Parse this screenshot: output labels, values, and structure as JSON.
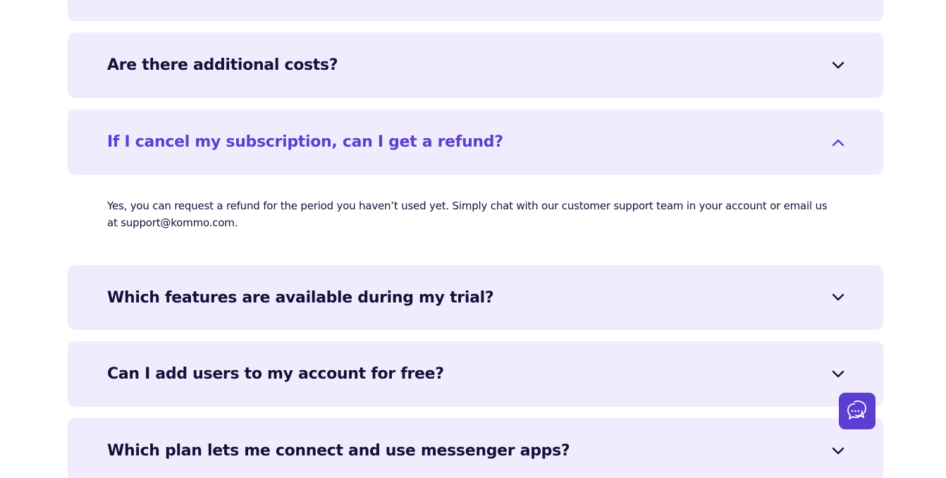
{
  "faq": {
    "items": [
      {
        "question": "",
        "open": false
      },
      {
        "question": "Are there additional costs?",
        "open": false
      },
      {
        "question": "If I cancel my subscription, can I get a refund?",
        "open": true,
        "answer": "Yes, you can request a refund for the period you haven’t used yet. Simply chat with our customer support team in your account or email us at support@kommo.com."
      },
      {
        "question": "Which features are available during my trial?",
        "open": false
      },
      {
        "question": "Can I add users to my account for free?",
        "open": false
      },
      {
        "question": "Which plan lets me connect and use messenger apps?",
        "open": false
      }
    ]
  },
  "icons": {
    "collapsed": "chevron-down-icon",
    "expanded": "chevron-up-icon",
    "chat": "chat-bubbles-icon"
  },
  "colors": {
    "card_background": "#f1ecfd",
    "text": "#15103a",
    "accent": "#5b3fd0"
  }
}
